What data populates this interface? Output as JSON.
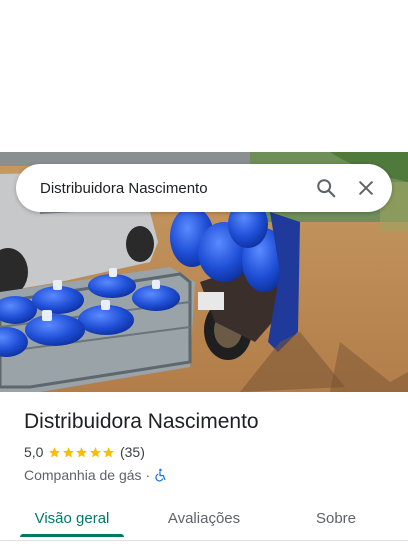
{
  "search": {
    "query": "Distribuidora Nascimento"
  },
  "place": {
    "name": "Distribuidora Nascimento",
    "rating": "5,0",
    "stars": 5,
    "review_count": "(35)",
    "category": "Companhia de gás",
    "separator": "·",
    "accessibility_icon": "wheelchair-icon"
  },
  "tabs": [
    {
      "label": "Visão geral",
      "active": true
    },
    {
      "label": "Avaliações",
      "active": false
    },
    {
      "label": "Sobre",
      "active": false
    }
  ],
  "colors": {
    "accent": "#00796b",
    "star": "#fbbc04",
    "accessibility": "#1a73e8",
    "jug_blue": "#1f4fd6"
  }
}
